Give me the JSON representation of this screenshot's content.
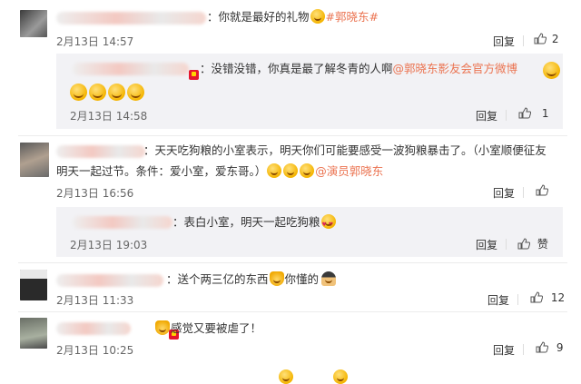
{
  "comments": [
    {
      "text": "：你就是最好的礼物",
      "hashtag": "#郭晓东#",
      "date": "2月13日 14:57",
      "reply_label": "回复",
      "like_count": "2",
      "sub_reply": {
        "text": "：没错没错，你真是最了解冬青的人啊",
        "mention": "@郭晓东影友会官方微博",
        "date": "2月13日 14:58",
        "reply_label": "回复",
        "like_count": "1"
      }
    },
    {
      "text_line1": "：天天吃狗粮的小室表示，明天你们可能要感受一波狗粮暴击了。（小室顺便征友",
      "text_line2": "明天一起过节。条件：爱小室，爱东哥。）",
      "mention": "@演员郭晓东",
      "date": "2月13日 16:56",
      "reply_label": "回复",
      "like_count": "",
      "sub_reply": {
        "text": "：表白小室，明天一起吃狗粮",
        "date": "2月13日 19:03",
        "reply_label": "回复",
        "like_label": "赞"
      }
    },
    {
      "text": "：送个两三亿的东西",
      "text_after": "你懂的",
      "date": "2月13日 11:33",
      "reply_label": "回复",
      "like_count": "12"
    },
    {
      "text": "感觉又要被虐了！",
      "date": "2月13日 10:25",
      "reply_label": "回复",
      "like_count": "9"
    }
  ]
}
